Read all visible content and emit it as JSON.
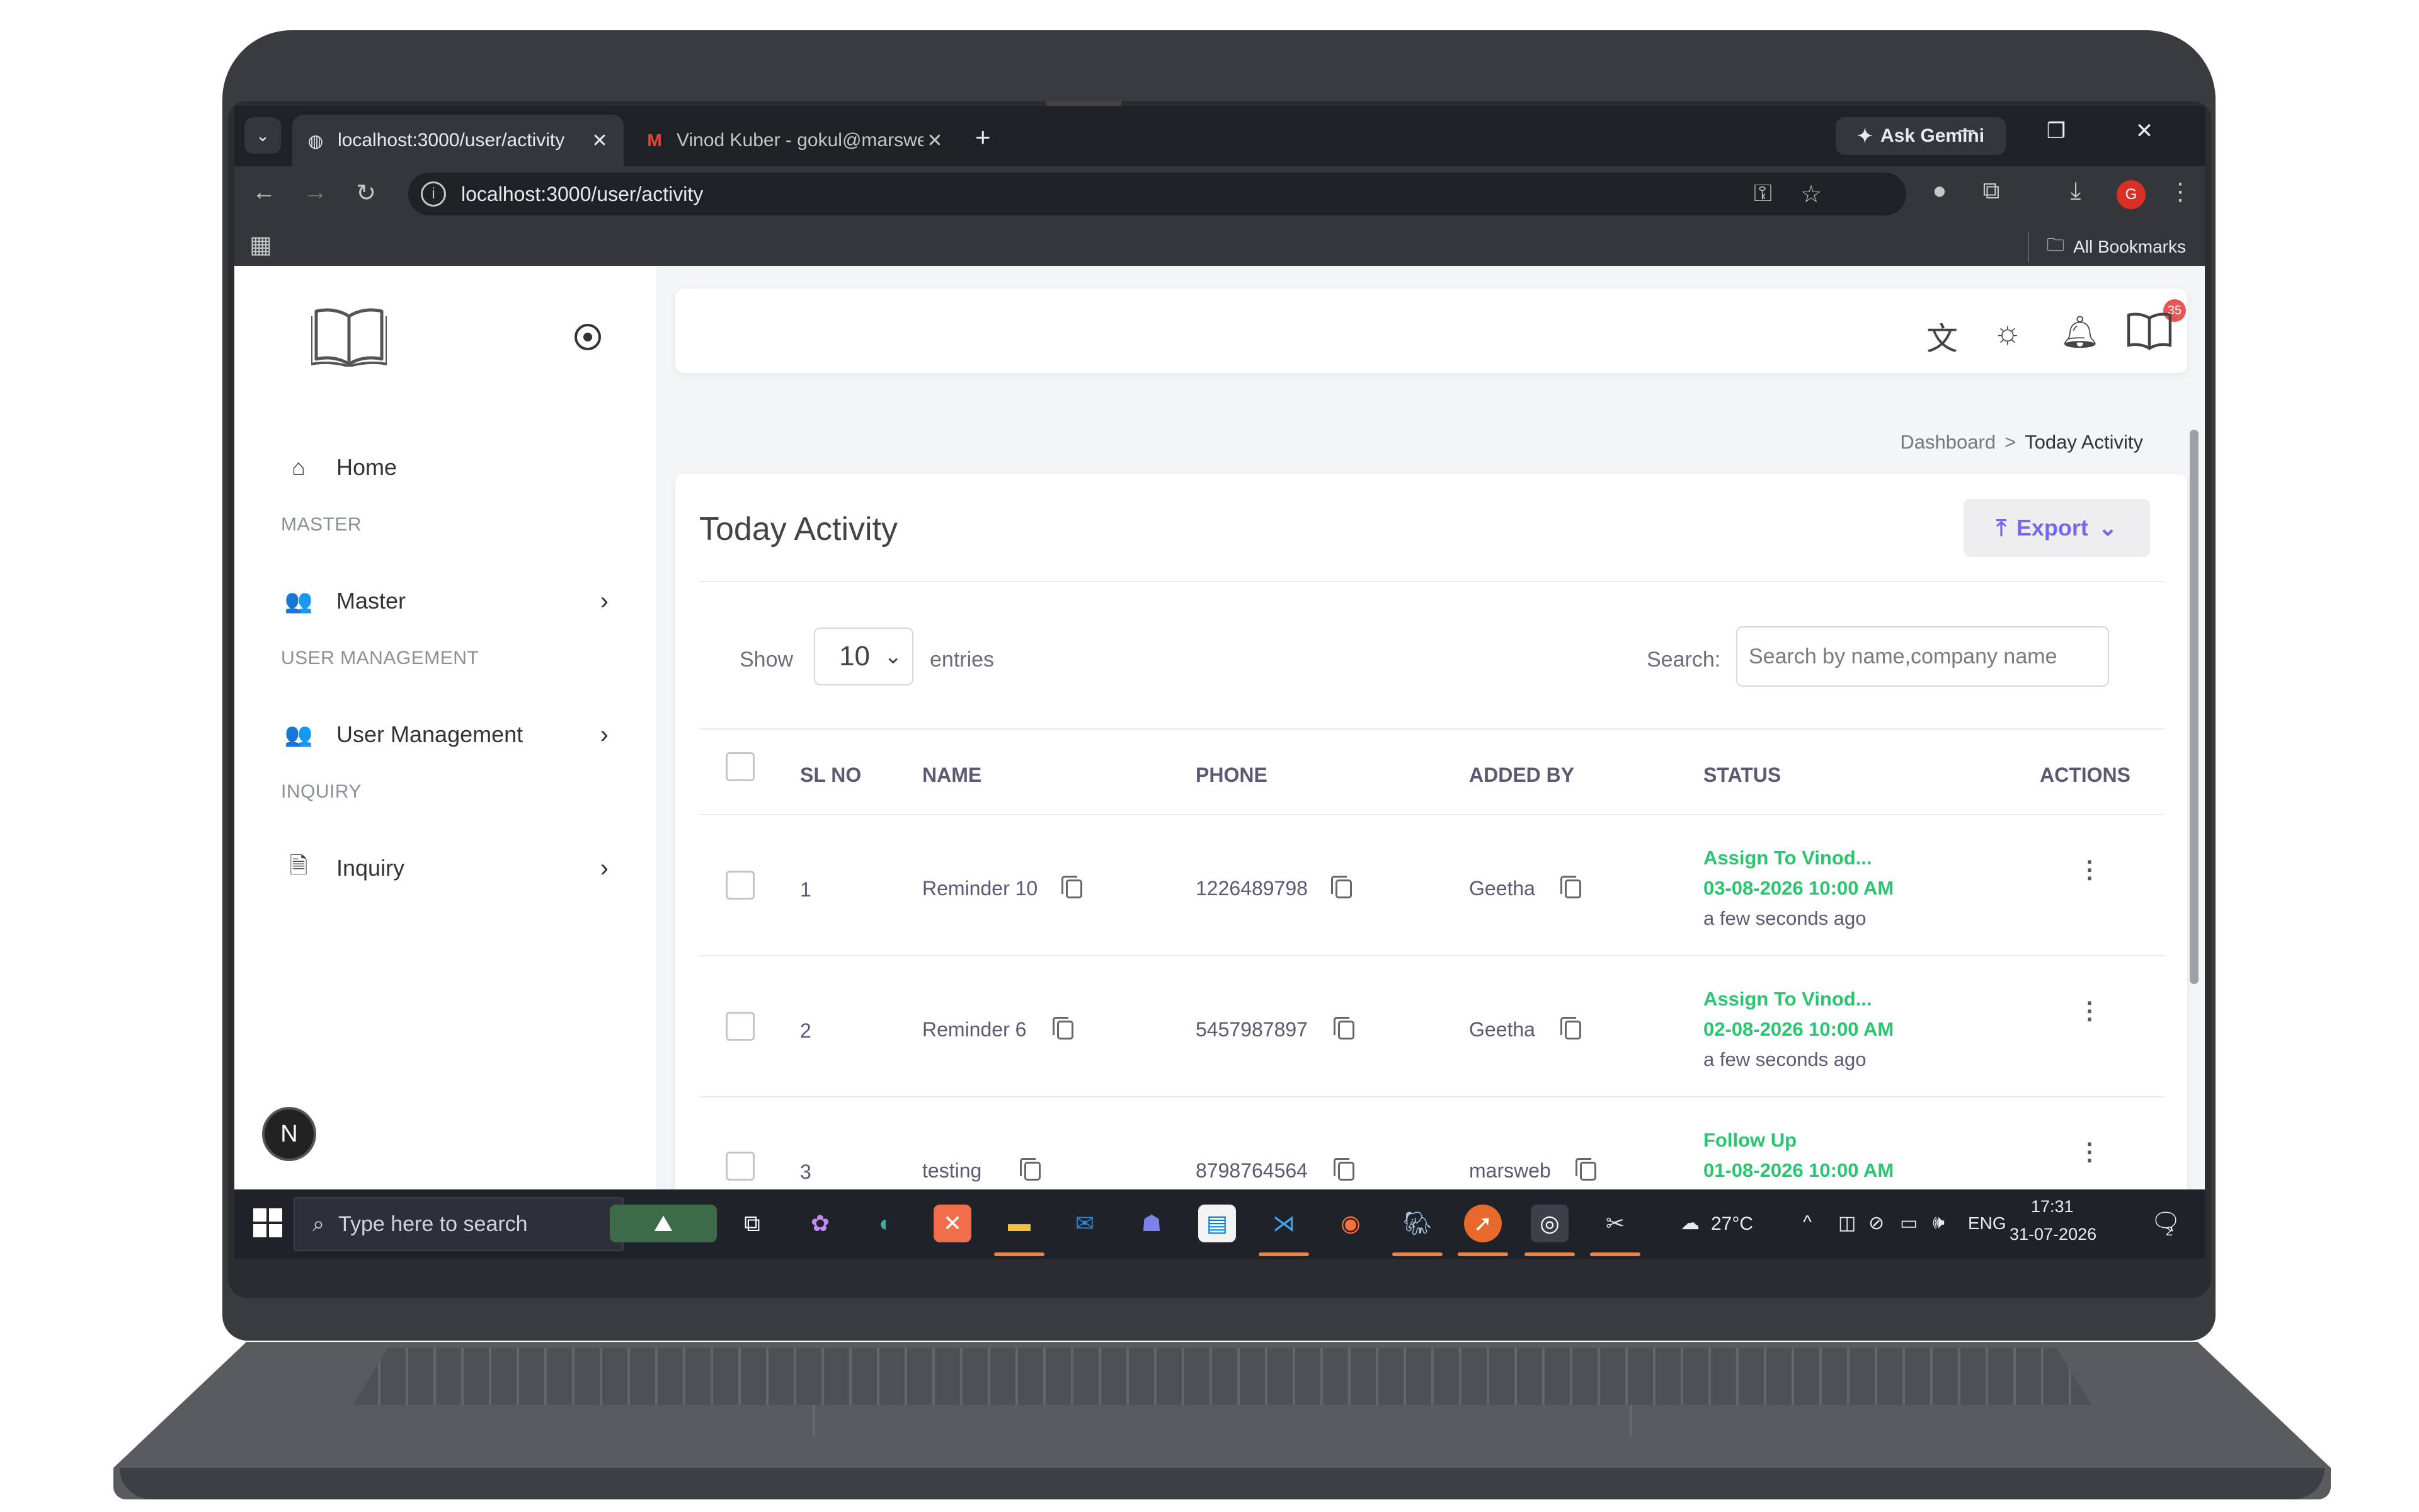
{
  "browser": {
    "tabs": [
      {
        "title": "localhost:3000/user/activity",
        "active": true
      },
      {
        "title": "Vinod Kuber - gokul@marsweb",
        "active": false
      }
    ],
    "new_tab": "+",
    "ask_gemini": "Ask Gemini",
    "url": "localhost:3000/user/activity",
    "all_bookmarks": "All Bookmarks",
    "profile_initial": "G"
  },
  "sidebar": {
    "home": "Home",
    "sections": [
      {
        "header": "MASTER",
        "item": "Master"
      },
      {
        "header": "USER MANAGEMENT",
        "item": "User Management"
      },
      {
        "header": "INQUIRY",
        "item": "Inquiry"
      }
    ],
    "avatar": "N"
  },
  "topbar": {
    "notification_count": "35"
  },
  "breadcrumb": {
    "parent": "Dashboard",
    "separator": ">",
    "current": "Today Activity"
  },
  "card": {
    "title": "Today Activity",
    "export_label": "Export",
    "show_label": "Show",
    "entries_value": "10",
    "entries_label": "entries",
    "search_label": "Search:",
    "search_placeholder": "Search by name,company name"
  },
  "table": {
    "headers": {
      "sl_no": "SL NO",
      "name": "NAME",
      "phone": "PHONE",
      "added_by": "ADDED BY",
      "status": "STATUS",
      "actions": "ACTIONS"
    },
    "rows": [
      {
        "sl": "1",
        "name": "Reminder 10",
        "phone": "1226489798",
        "added_by": "Geetha",
        "status": "Assign To Vinod...",
        "date": "03-08-2026  10:00 AM",
        "ago": "a few seconds ago"
      },
      {
        "sl": "2",
        "name": "Reminder 6",
        "phone": "5457987897",
        "added_by": "Geetha",
        "status": "Assign To Vinod...",
        "date": "02-08-2026  10:00 AM",
        "ago": "a few seconds ago"
      },
      {
        "sl": "3",
        "name": "testing",
        "phone": "8798764564",
        "added_by": "marsweb",
        "status": "Follow Up",
        "date": "01-08-2026  10:00 AM",
        "ago": ""
      }
    ]
  },
  "taskbar": {
    "search_placeholder": "Type here to search",
    "weather": "27°C",
    "language": "ENG",
    "time": "17:31",
    "date": "31-07-2026",
    "notification_count": "2"
  },
  "colors": {
    "accent": "#7367f0",
    "status_green": "#28c76f",
    "badge_red": "#ea5455"
  }
}
